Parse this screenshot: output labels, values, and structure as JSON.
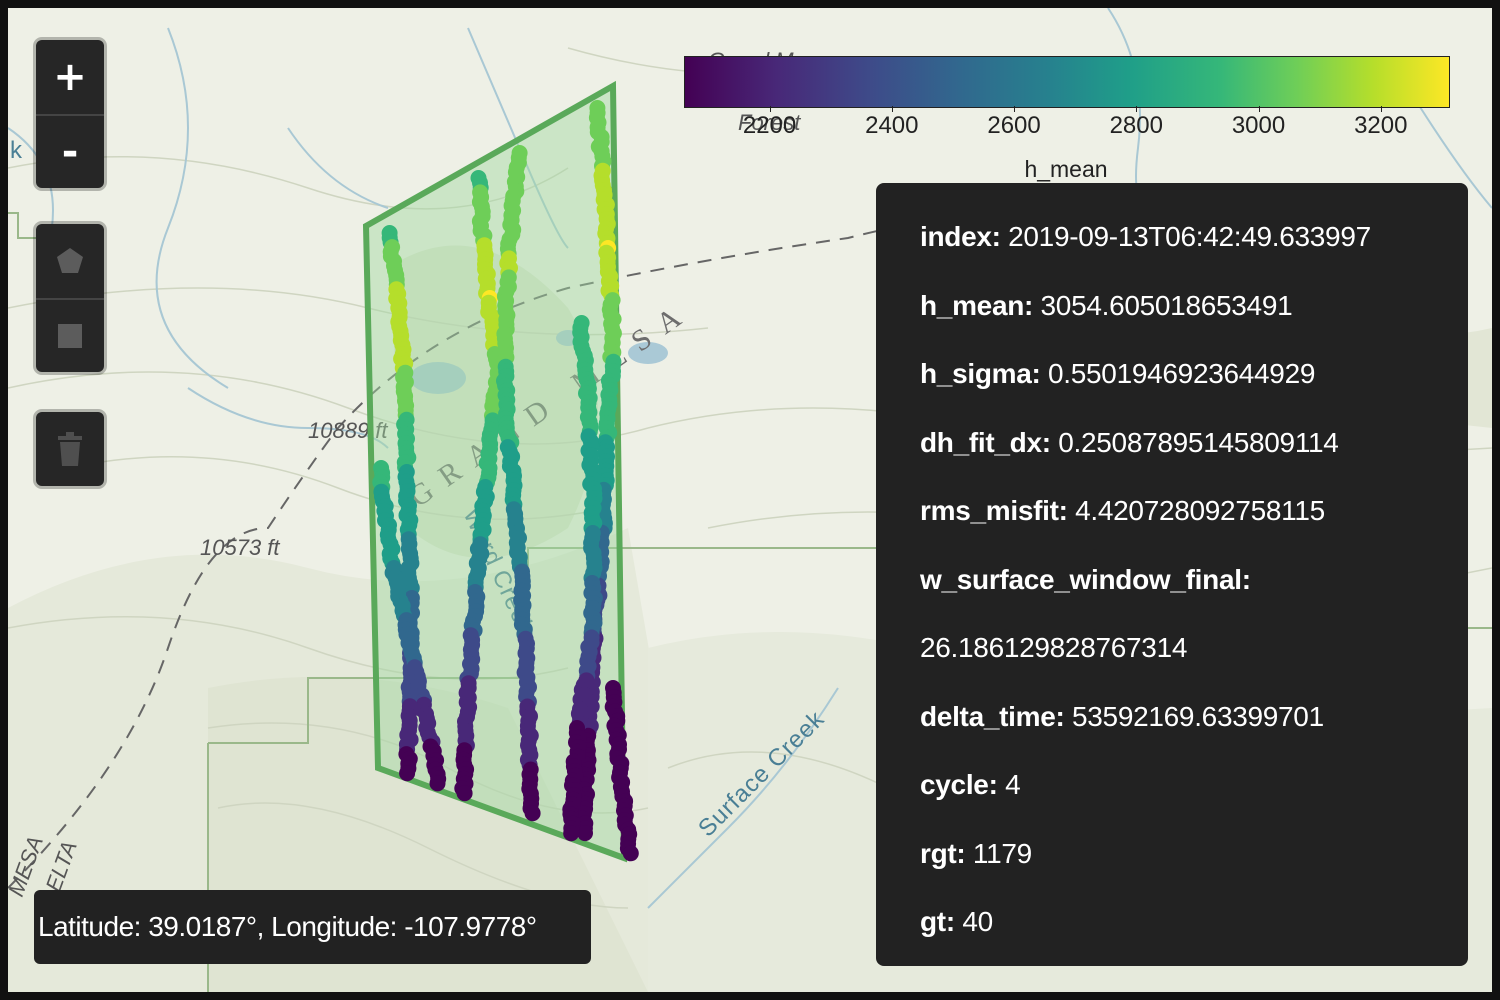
{
  "map": {
    "labels": {
      "elev_1": "10889 ft",
      "elev_2": "10573 ft",
      "mesa": "GRAND MESA",
      "surface_creek": "Surface Creek",
      "ward_creek": "Ward Creek",
      "mesa_corner": "MESA",
      "delta_corner": "DELTA",
      "grand_mesa_top": "Grand Mesa",
      "forest_top": "Forest",
      "creek_left": "k"
    },
    "colors": {
      "terrain": "#eef0e6",
      "hill": "#dde3cf",
      "contour": "#c9d1b8",
      "water": "#aac9d6",
      "boundary": "#9ab88a",
      "polygon_stroke": "#5aa95a",
      "polygon_fill": "#9fd69f"
    }
  },
  "controls": {
    "zoom_in": "+",
    "zoom_out": "-",
    "draw_polygon_icon": "polygon-icon",
    "draw_rectangle_icon": "square-icon",
    "delete_icon": "trash-icon"
  },
  "colorbar": {
    "label": "h_mean",
    "colormap": "viridis",
    "range": [
      2060,
      3310
    ],
    "ticks": [
      "2200",
      "2400",
      "2600",
      "2800",
      "3000",
      "3200"
    ]
  },
  "popup": {
    "rows": [
      {
        "key": "index:",
        "value": "2019-09-13T06:42:49.633997"
      },
      {
        "key": "h_mean:",
        "value": "3054.605018653491"
      },
      {
        "key": "h_sigma:",
        "value": "0.5501946923644929"
      },
      {
        "key": "dh_fit_dx:",
        "value": "0.25087895145809114"
      },
      {
        "key": "rms_misfit:",
        "value": "4.420728092758115"
      },
      {
        "key": "w_surface_window_final:",
        "value": ""
      },
      {
        "key": "",
        "value": "26.186129828767314"
      },
      {
        "key": "delta_time:",
        "value": "53592169.63399701"
      },
      {
        "key": "cycle:",
        "value": "4"
      },
      {
        "key": "rgt:",
        "value": "1179"
      },
      {
        "key": "gt:",
        "value": "40"
      }
    ]
  },
  "coordinates": {
    "text": "Latitude: 39.0187°, Longitude: -107.9778°"
  }
}
